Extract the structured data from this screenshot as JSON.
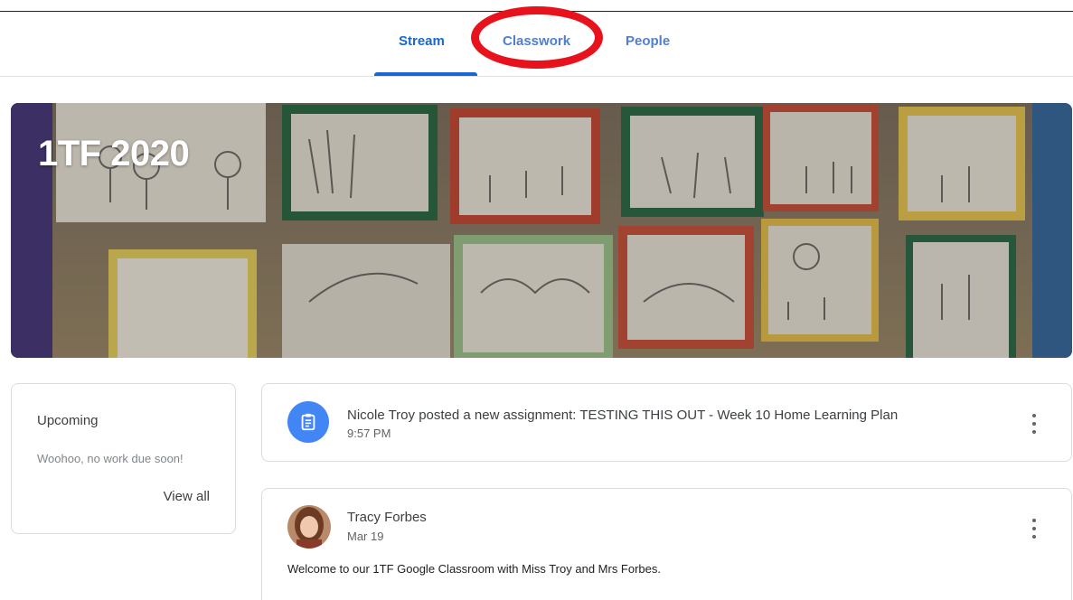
{
  "tabs": {
    "stream": "Stream",
    "classwork": "Classwork",
    "people": "People",
    "active": "Stream"
  },
  "annotation": {
    "shape": "red-oval",
    "target": "Classwork",
    "color": "#e8121c"
  },
  "banner": {
    "title": "1TF 2020"
  },
  "upcoming": {
    "title": "Upcoming",
    "empty_text": "Woohoo, no work due soon!",
    "view_all": "View all"
  },
  "stream": {
    "posts": [
      {
        "icon": "assignment-icon",
        "title": "Nicole Troy posted a new assignment: TESTING THIS OUT - Week 10 Home Learning Plan",
        "time": "9:57 PM"
      },
      {
        "icon": "avatar",
        "author": "Tracy Forbes",
        "date": "Mar 19",
        "text": "Welcome to our 1TF Google Classroom with Miss Troy and Mrs Forbes."
      }
    ]
  },
  "colors": {
    "accent": "#1967d2",
    "assignment": "#4285f4",
    "highlight": "#e8121c"
  }
}
